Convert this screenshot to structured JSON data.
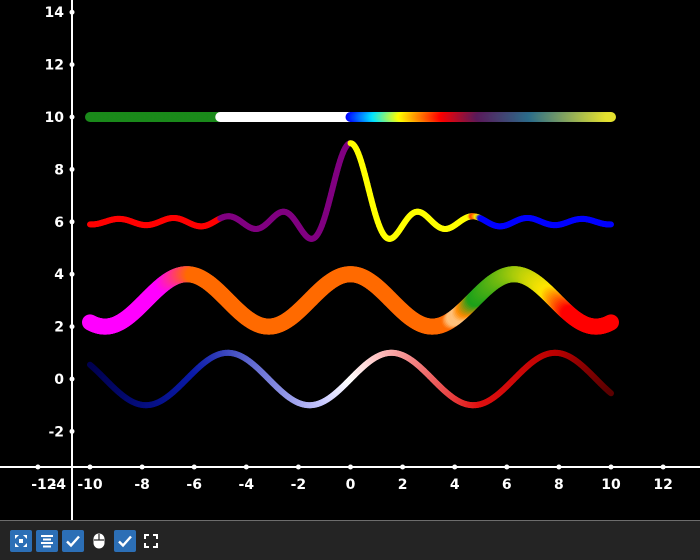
{
  "chart_data": {
    "type": "line",
    "title": "",
    "xlabel": "",
    "ylabel": "",
    "xlim": [
      -13,
      13
    ],
    "ylim": [
      -3.5,
      14.5
    ],
    "x_ticks": [
      -12,
      -10,
      -8,
      -6,
      -4,
      -2,
      0,
      2,
      4,
      6,
      8,
      10,
      12
    ],
    "x_tick_labels": [
      "-12",
      "-10",
      "-8",
      "-6",
      "-4",
      "-2",
      "0",
      "2",
      "4",
      "6",
      "8",
      "10",
      "12"
    ],
    "y_ticks": [
      -4,
      -2,
      0,
      2,
      4,
      6,
      8,
      10,
      12,
      14
    ],
    "y_tick_labels": [
      "-4",
      "-2",
      "0",
      "2",
      "4",
      "6",
      "8",
      "10",
      "12",
      "14"
    ],
    "grid": false,
    "background": "#000000",
    "axis_color": "#ffffff",
    "series": [
      {
        "x_range": [
          -10,
          10
        ],
        "formula": "y = 10",
        "color_stops": [
          [
            0.0,
            "#1b8a1b"
          ],
          [
            0.25,
            "#1b8a1b"
          ],
          [
            0.251,
            "#ffffff"
          ],
          [
            0.499,
            "#ffffff"
          ],
          [
            0.5,
            "#0000ff"
          ],
          [
            0.55,
            "#00e5ff"
          ],
          [
            0.6,
            "#ffff00"
          ],
          [
            0.68,
            "#ff0000"
          ],
          [
            0.75,
            "#5a1a5a"
          ],
          [
            0.85,
            "#2b6c8a"
          ],
          [
            1.0,
            "#e6e22e"
          ]
        ]
      },
      {
        "x_range": [
          -10,
          10
        ],
        "formula": "y = 6 + 3*sin(3x)/(3x) (x=0 -> 9)",
        "color_stops": [
          [
            0.0,
            "#ff0000"
          ],
          [
            0.249,
            "#ff0000"
          ],
          [
            0.25,
            "#800080"
          ],
          [
            0.499,
            "#800080"
          ],
          [
            0.5,
            "#ffff00"
          ],
          [
            0.73,
            "#ffff00"
          ],
          [
            0.735,
            "#ff3300"
          ],
          [
            0.745,
            "#ffff00"
          ],
          [
            0.75,
            "#0000ff"
          ],
          [
            1.0,
            "#0000ff"
          ]
        ]
      },
      {
        "x_range": [
          -10,
          10
        ],
        "formula": "y = 3 + cos(x)",
        "color_stops": [
          [
            0.0,
            "#ff00ff"
          ],
          [
            0.14,
            "#ff00ff"
          ],
          [
            0.2,
            "#ff6a00"
          ],
          [
            0.69,
            "#ff6a00"
          ],
          [
            0.7,
            "#ffc07a"
          ],
          [
            0.71,
            "#ffc07a"
          ],
          [
            0.72,
            "#ff8a00"
          ],
          [
            0.74,
            "#1aa01a"
          ],
          [
            0.88,
            "#ffe500"
          ],
          [
            0.92,
            "#ff0000"
          ],
          [
            1.0,
            "#ff0000"
          ]
        ]
      },
      {
        "x_range": [
          -10,
          10
        ],
        "formula": "y = sin(x)",
        "color_stops": [
          [
            0.0,
            "#00004d"
          ],
          [
            0.2,
            "#0a1aa8"
          ],
          [
            0.45,
            "#c8c8ff"
          ],
          [
            0.5,
            "#ffffff"
          ],
          [
            0.55,
            "#ffc8c8"
          ],
          [
            0.75,
            "#e01010"
          ],
          [
            0.9,
            "#bb0000"
          ],
          [
            1.0,
            "#5a0000"
          ]
        ]
      }
    ]
  },
  "toolbar": {
    "icons": [
      "fit-view-icon",
      "align-icon",
      "check-icon",
      "mouse-icon",
      "check-icon",
      "fullscreen-icon"
    ],
    "accent": "#2c6fb6"
  }
}
